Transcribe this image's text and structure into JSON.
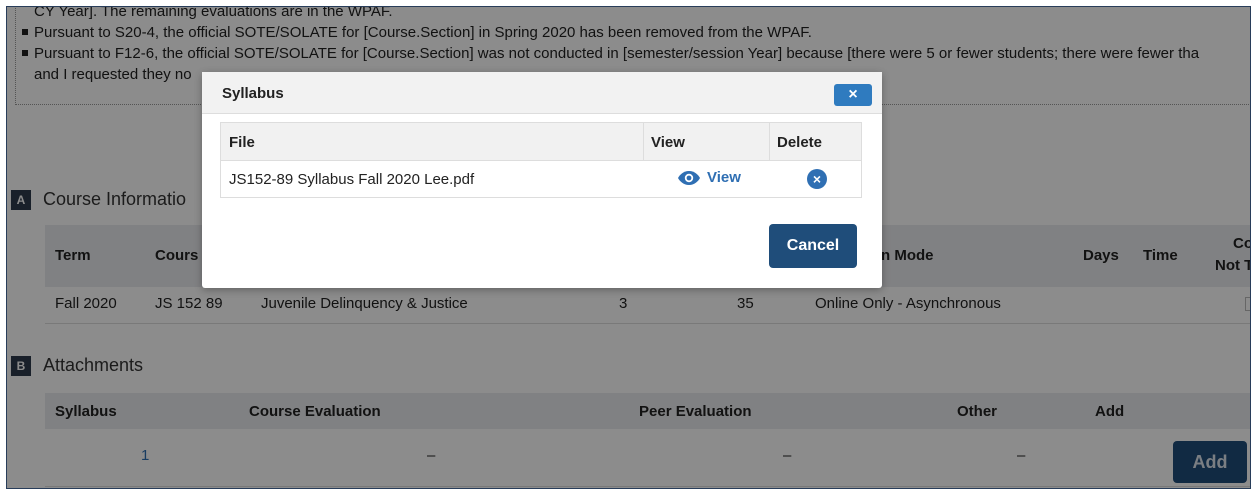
{
  "notice": {
    "line1": "CY Year]. The remaining evaluations are in the WPAF.",
    "line2": "Pursuant to S20-4, the official SOTE/SOLATE for [Course.Section] in Spring 2020 has been removed from the WPAF.",
    "line3": "Pursuant to F12-6, the official SOTE/SOLATE for [Course.Section] was not conducted in [semester/session Year] because [there were 5 or fewer students; there were fewer tha",
    "line4": "and I requested they no"
  },
  "section_a": {
    "badge": "A",
    "title": "Course Informatio"
  },
  "course_table": {
    "headers": {
      "term": "Term",
      "course": "Cours",
      "mode": "n Mode",
      "days": "Days",
      "time": "Time",
      "co1": "Co",
      "co2": "Not T"
    },
    "row": {
      "term": "Fall 2020",
      "course": "JS 152 89",
      "title": "Juvenile Delinquency & Justice",
      "units": "3",
      "enrollment": "35",
      "mode": "Online Only - Asynchronous"
    }
  },
  "section_b": {
    "badge": "B",
    "title": "Attachments"
  },
  "attachments": {
    "headers": {
      "syllabus": "Syllabus",
      "course_eval": "Course Evaluation",
      "peer_eval": "Peer Evaluation",
      "other": "Other",
      "add": "Add"
    },
    "row": {
      "syllabus": "1",
      "course_eval": "–",
      "peer_eval": "–",
      "other": "–"
    },
    "add_button": "Add"
  },
  "modal": {
    "title": "Syllabus",
    "close_label": "×",
    "table_headers": {
      "file": "File",
      "view": "View",
      "delete": "Delete"
    },
    "file_row": {
      "file": "JS152-89 Syllabus Fall 2020 Lee.pdf",
      "view_label": "View",
      "delete_icon": "x-circle-icon"
    },
    "cancel_button": "Cancel"
  },
  "colors": {
    "primary": "#1f4d7a",
    "link": "#2f6fb3",
    "close": "#2f7bbf"
  }
}
